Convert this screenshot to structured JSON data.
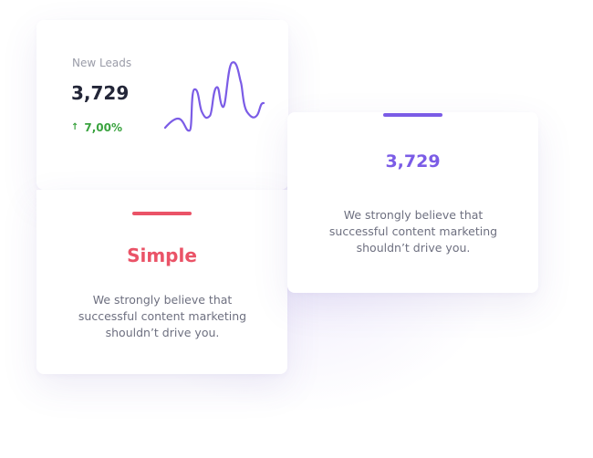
{
  "colors": {
    "accent_purple": "#7B5CE6",
    "accent_red": "#EA5367",
    "positive_green": "#3AA33F",
    "heading_dark": "#232638",
    "text_gray": "#6E7080",
    "label_gray": "#9A9CA8"
  },
  "leads_card": {
    "label": "New Leads",
    "value": "3,729",
    "change": "7,00%",
    "change_icon": "arrow-up-icon"
  },
  "simple_card": {
    "title": "Simple",
    "description": "We strongly believe that successful content marketing shouldn’t drive you."
  },
  "stat_card": {
    "title": "3,729",
    "description": "We strongly believe that successful content marketing shouldn’t drive you."
  }
}
